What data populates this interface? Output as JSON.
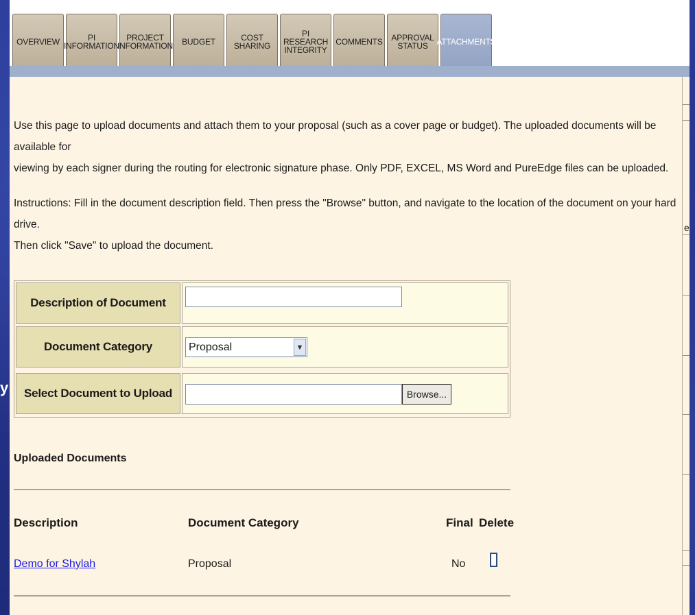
{
  "tabs": [
    {
      "label": "OVERVIEW",
      "active": false
    },
    {
      "label": "PI INFORMATION",
      "active": false
    },
    {
      "label": "PROJECT INFORMATION",
      "active": false
    },
    {
      "label": "BUDGET",
      "active": false
    },
    {
      "label": "COST SHARING",
      "active": false
    },
    {
      "label": "PI RESEARCH INTEGRITY",
      "active": false
    },
    {
      "label": "COMMENTS",
      "active": false
    },
    {
      "label": "APPROVAL STATUS",
      "active": false
    },
    {
      "label": "ATTACHMENTS",
      "active": true
    }
  ],
  "intro": {
    "line1": "Use this page to upload documents and attach them to your proposal (such as a cover page or budget). The uploaded documents will be available for",
    "line2": "viewing by each signer during the routing for electronic signature phase. Only PDF, EXCEL, MS Word and PureEdge files can be uploaded."
  },
  "instructions": {
    "line1": "Instructions: Fill in the document description field. Then press the \"Browse\" button, and navigate to the location of the document on your hard drive.",
    "line2": "Then click \"Save\" to upload the document."
  },
  "form": {
    "description_label": "Description of Document",
    "description_value": "",
    "category_label": "Document Category",
    "category_value": "Proposal",
    "upload_label": "Select Document to Upload",
    "upload_value": "",
    "browse_label": "Browse..."
  },
  "uploaded": {
    "title": "Uploaded Documents",
    "headers": {
      "description": "Description",
      "category": "Document Category",
      "final": "Final",
      "delete": "Delete"
    },
    "rows": [
      {
        "description": "Demo for Shylah",
        "category": "Proposal",
        "final": "No",
        "delete_checked": false
      }
    ]
  },
  "side_fragments": {
    "left_glyph": "y",
    "right_glyph": "e"
  },
  "colors": {
    "slide_background": "#26338c",
    "panel_background": "#fdf4e3",
    "label_background": "#e6dfb2",
    "active_tab": "#a8b6d2",
    "link": "#1a1ae6"
  }
}
